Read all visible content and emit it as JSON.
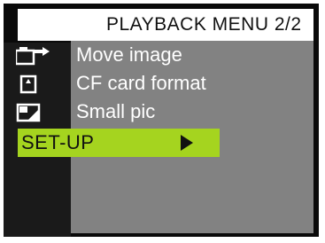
{
  "menu": {
    "title": "PLAYBACK MENU 2/2",
    "items": [
      {
        "label": "Move image",
        "icon": "move-image-icon"
      },
      {
        "label": "CF card format",
        "icon": "cf-card-icon"
      },
      {
        "label": "Small pic",
        "icon": "small-pic-icon"
      }
    ],
    "selected": {
      "label": "SET-UP",
      "arrow": "right-triangle-icon"
    }
  },
  "colors": {
    "highlight": "#a5d41f",
    "panel": "#828282",
    "frame": "#0a0a0a"
  }
}
